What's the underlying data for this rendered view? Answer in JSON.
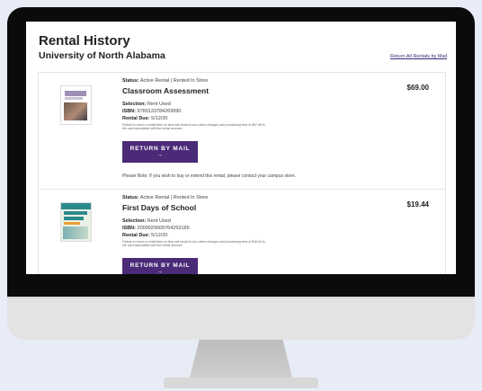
{
  "page": {
    "title": "Rental History",
    "subtitle": "University of North Alabama",
    "return_all_link": "Return All Rentals by Mail"
  },
  "rentals": [
    {
      "status_label": "Status:",
      "status_value": "Active Rental | Rented In Store",
      "title": "Classroom Assessment",
      "selection_label": "Selection:",
      "selection_value": "Rent Used",
      "isbn_label": "ISBN:",
      "isbn_value": "9780133784269990",
      "due_label": "Rental Due:",
      "due_value": "5/12/20",
      "fine_print": "Failure to return a rental item on time will result in non-return charges and processing fees of $57.98 to the card associated with the rental account.",
      "button_label": "RETURN BY MAIL →",
      "note": "Please Note: If you wish to buy or extend this rental, please contact your campus store.",
      "price": "$69.00"
    },
    {
      "status_label": "Status:",
      "status_value": "Active Rental | Rented In Store",
      "title": "First Days of School",
      "selection_label": "Selection:",
      "selection_value": "Rent Used",
      "isbn_label": "ISBN:",
      "isbn_value": "2000029009764253185",
      "due_label": "Rental Due:",
      "due_value": "5/12/20",
      "fine_print": "Failure to return a rental item on time will result in non-return charges and processing fees of $18.60 to the card associated with the rental account.",
      "button_label": "RETURN BY MAIL →",
      "price": "$19.44"
    }
  ],
  "colors": {
    "accent": "#4b2a78",
    "background": "#e8ecf6"
  }
}
